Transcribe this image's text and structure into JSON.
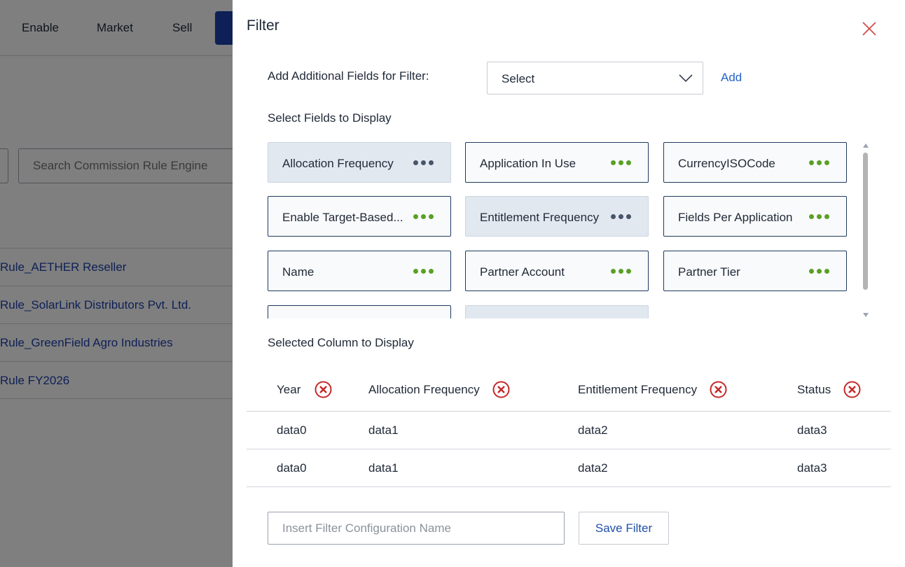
{
  "background": {
    "nav": [
      "Enable",
      "Market",
      "Sell"
    ],
    "search_placeholder": "Search Commission Rule Engine",
    "rows": [
      "Rule_AETHER Reseller",
      "Rule_SolarLink Distributors Pvt. Ltd.",
      "Rule_GreenField Agro Industries",
      "Rule FY2026"
    ]
  },
  "filter": {
    "title": "Filter",
    "add_fields_label": "Add Additional Fields for Filter:",
    "select_value": "Select",
    "add_label": "Add",
    "fields_label": "Select Fields to Display",
    "fields": [
      {
        "label": "Allocation Frequency",
        "selected": true
      },
      {
        "label": "Application In Use",
        "selected": false
      },
      {
        "label": "CurrencyISOCode",
        "selected": false
      },
      {
        "label": "Enable Target-Based...",
        "selected": false
      },
      {
        "label": "Entitlement Frequency",
        "selected": true
      },
      {
        "label": "Fields Per Application",
        "selected": false
      },
      {
        "label": "Name",
        "selected": false
      },
      {
        "label": "Partner Account",
        "selected": false
      },
      {
        "label": "Partner Tier",
        "selected": false
      },
      {
        "label": "",
        "selected": false
      },
      {
        "label": "",
        "selected": true
      }
    ],
    "selected_columns_label": "Selected Column to Display",
    "columns": [
      "Year",
      "Allocation Frequency",
      "Entitlement Frequency",
      "Status"
    ],
    "rows": [
      [
        "data0",
        "data1",
        "data2",
        "data3"
      ],
      [
        "data0",
        "data1",
        "data2",
        "data3"
      ]
    ],
    "config_placeholder": "Insert Filter Configuration Name",
    "save_label": "Save Filter"
  },
  "colors": {
    "accent": "#1e40af",
    "link": "#2563c9",
    "dots_unselected": "#5aa025",
    "dots_selected": "#475569",
    "remove": "#c62828",
    "close": "#d14b4b"
  }
}
